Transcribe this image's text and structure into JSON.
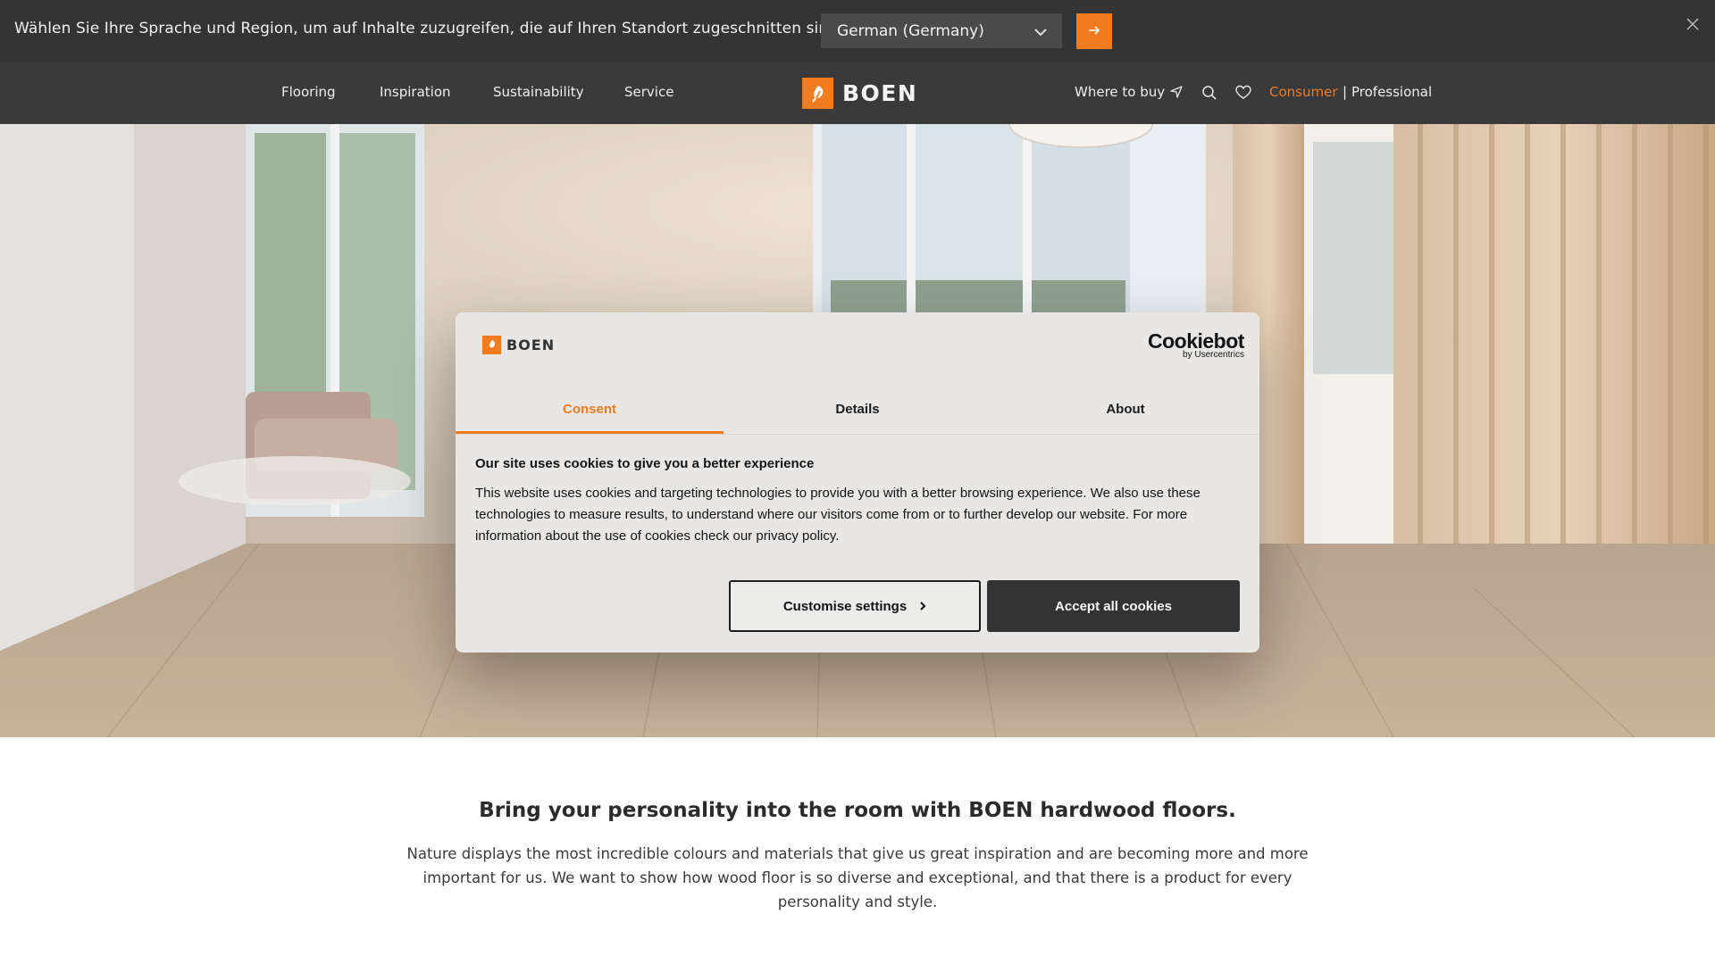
{
  "region_bar": {
    "message": "Wählen Sie Ihre Sprache und Region, um auf Inhalte zuzugreifen, die auf Ihren Standort zugeschnitten sind",
    "selected_region": "German (Germany)",
    "go_icon": "arrow-right-icon",
    "close_icon": "close-icon"
  },
  "nav": {
    "links": [
      "Flooring",
      "Inspiration",
      "Sustainability",
      "Service"
    ],
    "logo_text": "BOEN",
    "where_to_buy": "Where to buy",
    "consumer": "Consumer",
    "separator": "|",
    "professional": "Professional",
    "icons": [
      "navigation-arrow-icon",
      "search-icon",
      "heart-icon"
    ]
  },
  "cookie_dialog": {
    "logo_text": "BOEN",
    "brand": "Cookiebot",
    "brand_sub": "by Usercentrics",
    "tabs": [
      "Consent",
      "Details",
      "About"
    ],
    "active_tab": "Consent",
    "title": "Our site uses cookies to give you a better experience",
    "body": "This website uses cookies and targeting technologies to provide you with a better browsing experience. We also use these technologies to measure results, to understand where our visitors come from or to further develop our website. For more information about the use of cookies check our privacy policy.",
    "customise_label": "Customise settings",
    "accept_label": "Accept all cookies"
  },
  "intro": {
    "title": "Bring your personality into the room with BOEN hardwood floors.",
    "text": "Nature displays the most incredible colours and materials that give us great inspiration and are becoming more and more important for us. We want to show how wood floor is so diverse and exceptional, and that there is a product for every personality and style."
  },
  "colors": {
    "accent": "#f07c1f",
    "top_bar": "#343434",
    "nav_bar": "#3a3a3a",
    "dialog_bg": "#e9e7e5",
    "accept_button": "#333333"
  }
}
